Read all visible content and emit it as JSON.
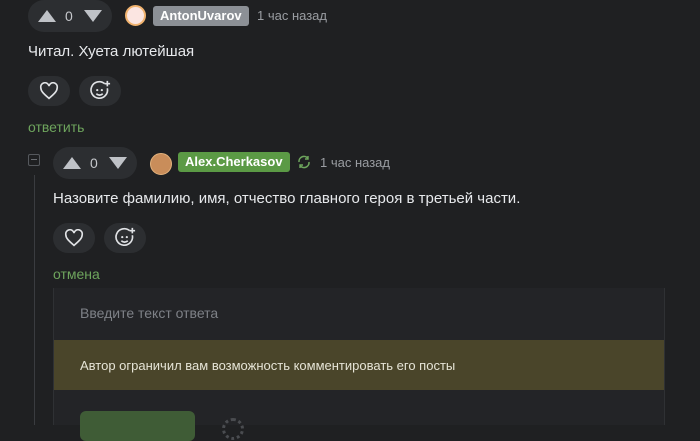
{
  "comment1": {
    "votes": "0",
    "username": "AntonUvarov",
    "time": "1 час назад",
    "text": "Читал. Хуета лютейшая",
    "reply_label": "ответить"
  },
  "comment2": {
    "votes": "0",
    "username": "Alex.Cherkasov",
    "time": "1 час назад",
    "text": "Назовите фамилию, имя, отчество главного героя в третьей части.",
    "cancel_label": "отмена"
  },
  "reply_form": {
    "placeholder": "Введите текст ответа",
    "restriction_notice": "Автор ограничил вам возможность комментировать его посты"
  },
  "colors": {
    "background": "#1f2022",
    "badge_gray": "#8c9096",
    "badge_green": "#5b9a45",
    "link_green": "#6ea55d",
    "notice_bg": "#4a452a"
  },
  "icons": [
    "vote-up-icon",
    "vote-down-icon",
    "heart-icon",
    "emoji-plus-icon",
    "collapse-icon",
    "cycle-icon"
  ]
}
